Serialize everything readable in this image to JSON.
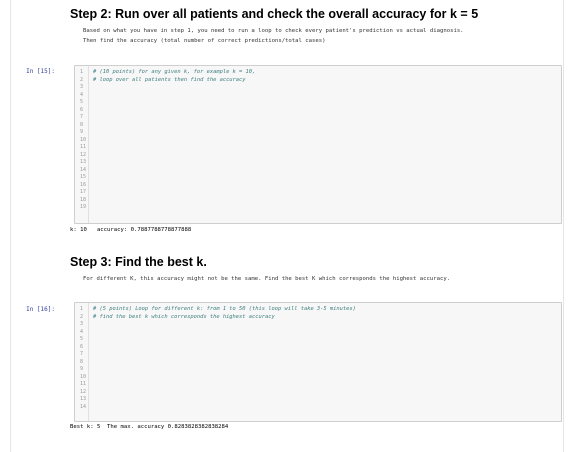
{
  "step2": {
    "title": "Step 2: Run over all patients and check the overall accuracy for k = 5",
    "desc_line1": "Based on what you have in step 1, you need to run a loop to check every patient's prediction vs actual diagnosis.",
    "desc_line2": "Then find the accuracy (total number of correct predictions/total cases)"
  },
  "cell15": {
    "prompt": "In [15]:",
    "line_numbers": [
      "1",
      "2",
      "3",
      "4",
      "5",
      "6",
      "7",
      "8",
      "9",
      "10",
      "11",
      "12",
      "13",
      "14",
      "15",
      "16",
      "17",
      "18",
      "19"
    ],
    "code_lines": [
      "# (10 points) for any given k, for example k = 10,",
      "# loop over all patients then find the accuracy"
    ],
    "output": "k: 10   accuracy: 0.7887788778877888"
  },
  "step3": {
    "title": "Step 3: Find the best k.",
    "desc_line1": "For different K, this accuracy might not be the same. Find the best K which corresponds the highest accuracy."
  },
  "cell16": {
    "prompt": "In [16]:",
    "line_numbers": [
      "1",
      "2",
      "3",
      "4",
      "5",
      "6",
      "7",
      "8",
      "9",
      "10",
      "11",
      "12",
      "13",
      "14"
    ],
    "code_lines": [
      "# (5 points) Loop for different k: from 1 to 50 (this loop will take 3-5 minutes)",
      "# find the best k which corresponds the highest accuracy"
    ],
    "output": "Best k: 5  The max. accuracy 0.8283828382838284"
  }
}
